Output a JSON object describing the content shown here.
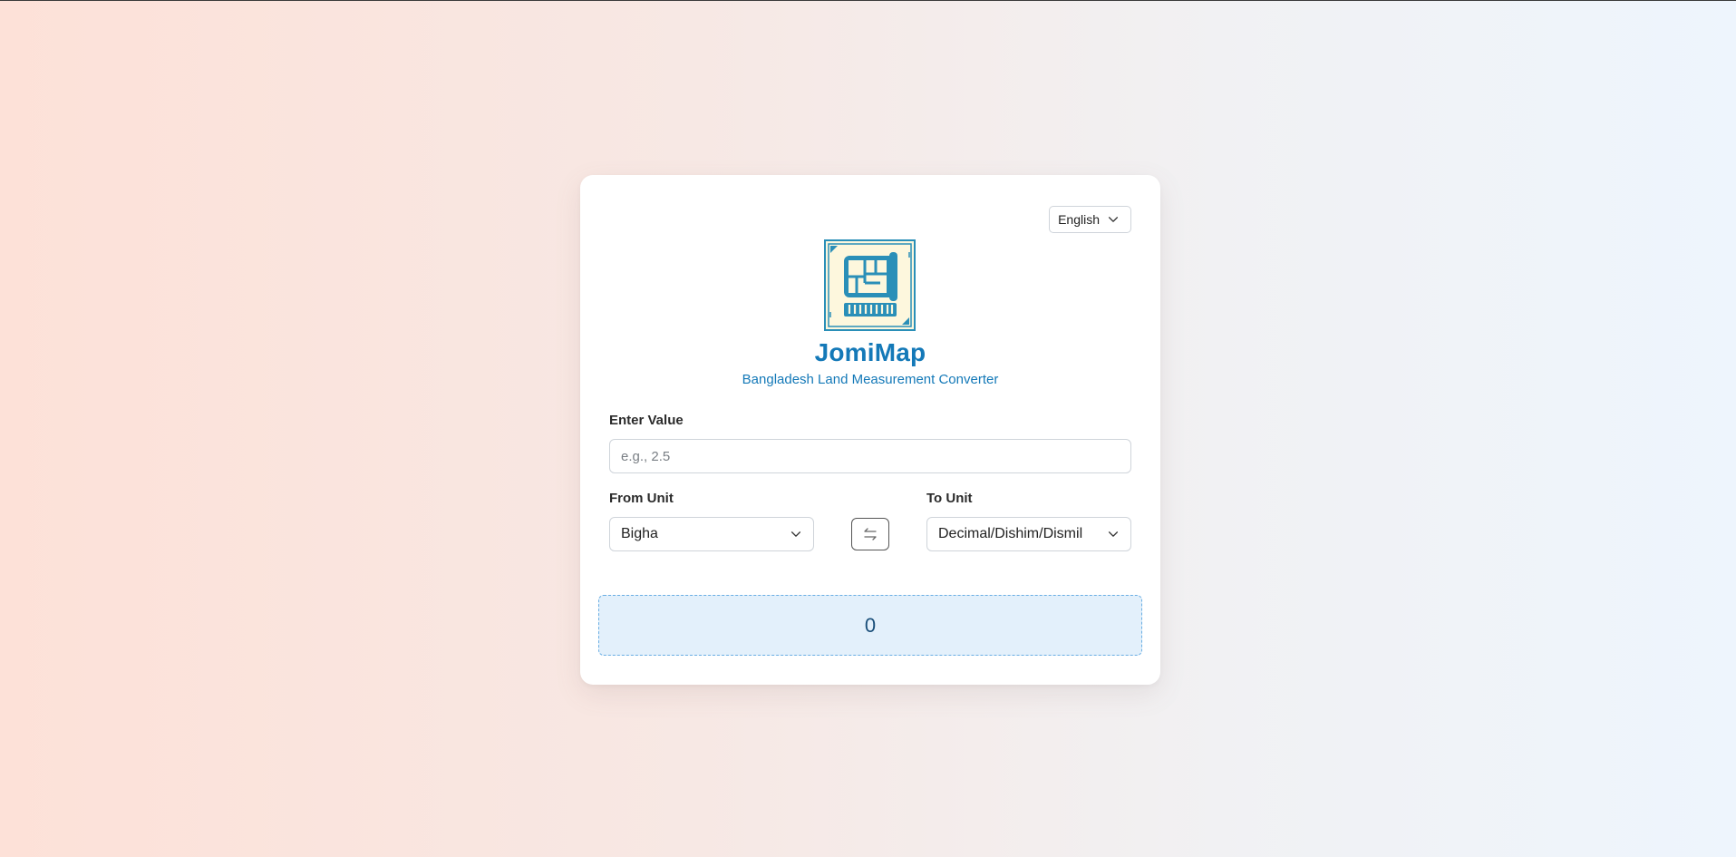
{
  "language": {
    "selected": "English"
  },
  "header": {
    "logo_icon": "land-blueprint-icon",
    "title": "JomiMap",
    "subtitle": "Bangladesh Land Measurement Converter"
  },
  "form": {
    "value_label": "Enter Value",
    "value_placeholder": "e.g., 2.5",
    "value": "",
    "from_label": "From Unit",
    "from_selected": "Bigha",
    "to_label": "To Unit",
    "to_selected": "Decimal/Dishim/Dismil",
    "swap_icon": "swap-arrows-icon"
  },
  "result": {
    "value": "0"
  },
  "colors": {
    "accent": "#1479b8",
    "result_bg": "#e3f0fb",
    "result_border": "#6aaee3",
    "logo_teal": "#2a8fb8",
    "logo_bg": "#fdf7dd"
  }
}
